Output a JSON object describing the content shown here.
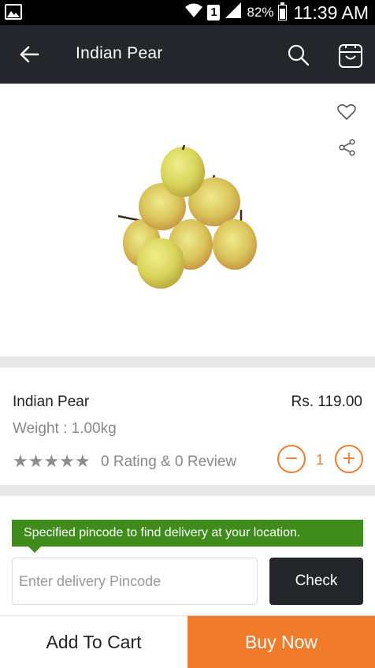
{
  "status_bar": {
    "sim_slot": "1",
    "battery": "82%",
    "battery_level": 0.82,
    "time": "11:39 AM"
  },
  "app_bar": {
    "title": "Indian Pear",
    "icons": [
      "back-arrow-icon",
      "search-icon",
      "cart-icon"
    ]
  },
  "product": {
    "name": "Indian Pear",
    "price": "Rs. 119.00",
    "weight": "Weight : 1.00kg",
    "stars": 5,
    "star_rating_value": 0,
    "rating_text": "0 Rating & 0 Review",
    "quantity": "1",
    "decrement": "−",
    "increment": "+",
    "icons": [
      "heart-icon",
      "share-icon"
    ]
  },
  "pincode": {
    "hint": "Specified pincode to find delivery at your location.",
    "placeholder": "Enter delivery Pincode",
    "value": "",
    "check_label": "Check"
  },
  "actions": {
    "add_to_cart": "Add To Cart",
    "buy_now": "Buy Now"
  },
  "colors": {
    "accent": "#f07b2b",
    "app_bar": "#25262b",
    "hint_green": "#3f8b1c"
  }
}
